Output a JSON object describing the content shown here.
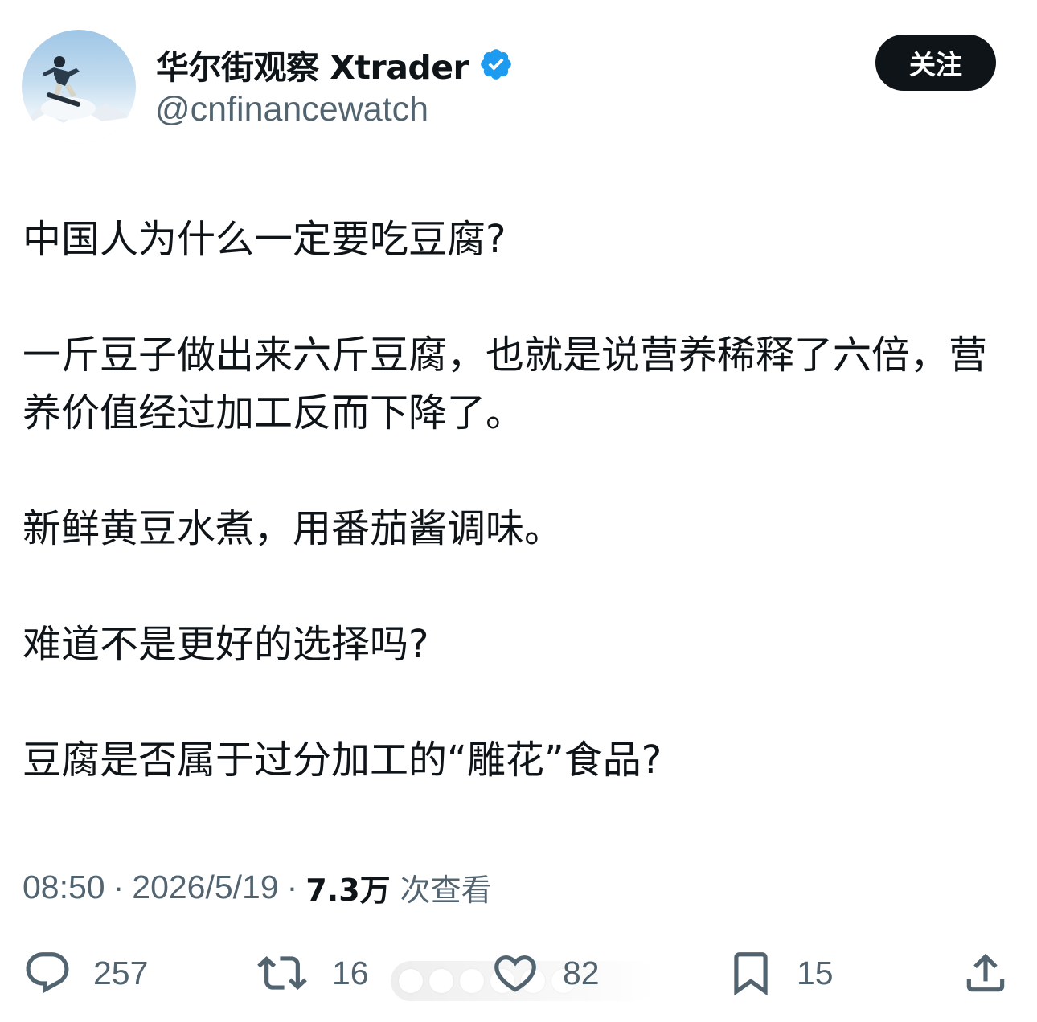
{
  "author": {
    "display_name": "华尔街观察 Xtrader",
    "handle": "@cnfinancewatch",
    "verified": true,
    "avatar_icon": "snowboarder-avatar"
  },
  "follow_label": "关注",
  "tweet": {
    "paragraphs": [
      "中国人为什么一定要吃豆腐?",
      "一斤豆子做出来六斤豆腐，也就是说营养稀释了六倍，营养价值经过加工反而下降了。",
      "新鲜黄豆水煮，用番茄酱调味。",
      "难道不是更好的选择吗?",
      "豆腐是否属于过分加工的“雕花”食品?"
    ]
  },
  "meta": {
    "time": "08:50",
    "separator": "·",
    "date": "2026/5/19",
    "views_count": "7.3万",
    "views_label": "次查看"
  },
  "actions": {
    "reply": {
      "icon": "reply-icon",
      "count": "257"
    },
    "retweet": {
      "icon": "retweet-icon",
      "count": "16"
    },
    "like": {
      "icon": "heart-icon",
      "count": "82"
    },
    "bookmark": {
      "icon": "bookmark-icon",
      "count": "15"
    },
    "share": {
      "icon": "share-icon"
    }
  },
  "colors": {
    "text_primary": "#0f1419",
    "text_secondary": "#536471",
    "verified_blue": "#1d9bf0",
    "follow_button_bg": "#0f1419"
  }
}
